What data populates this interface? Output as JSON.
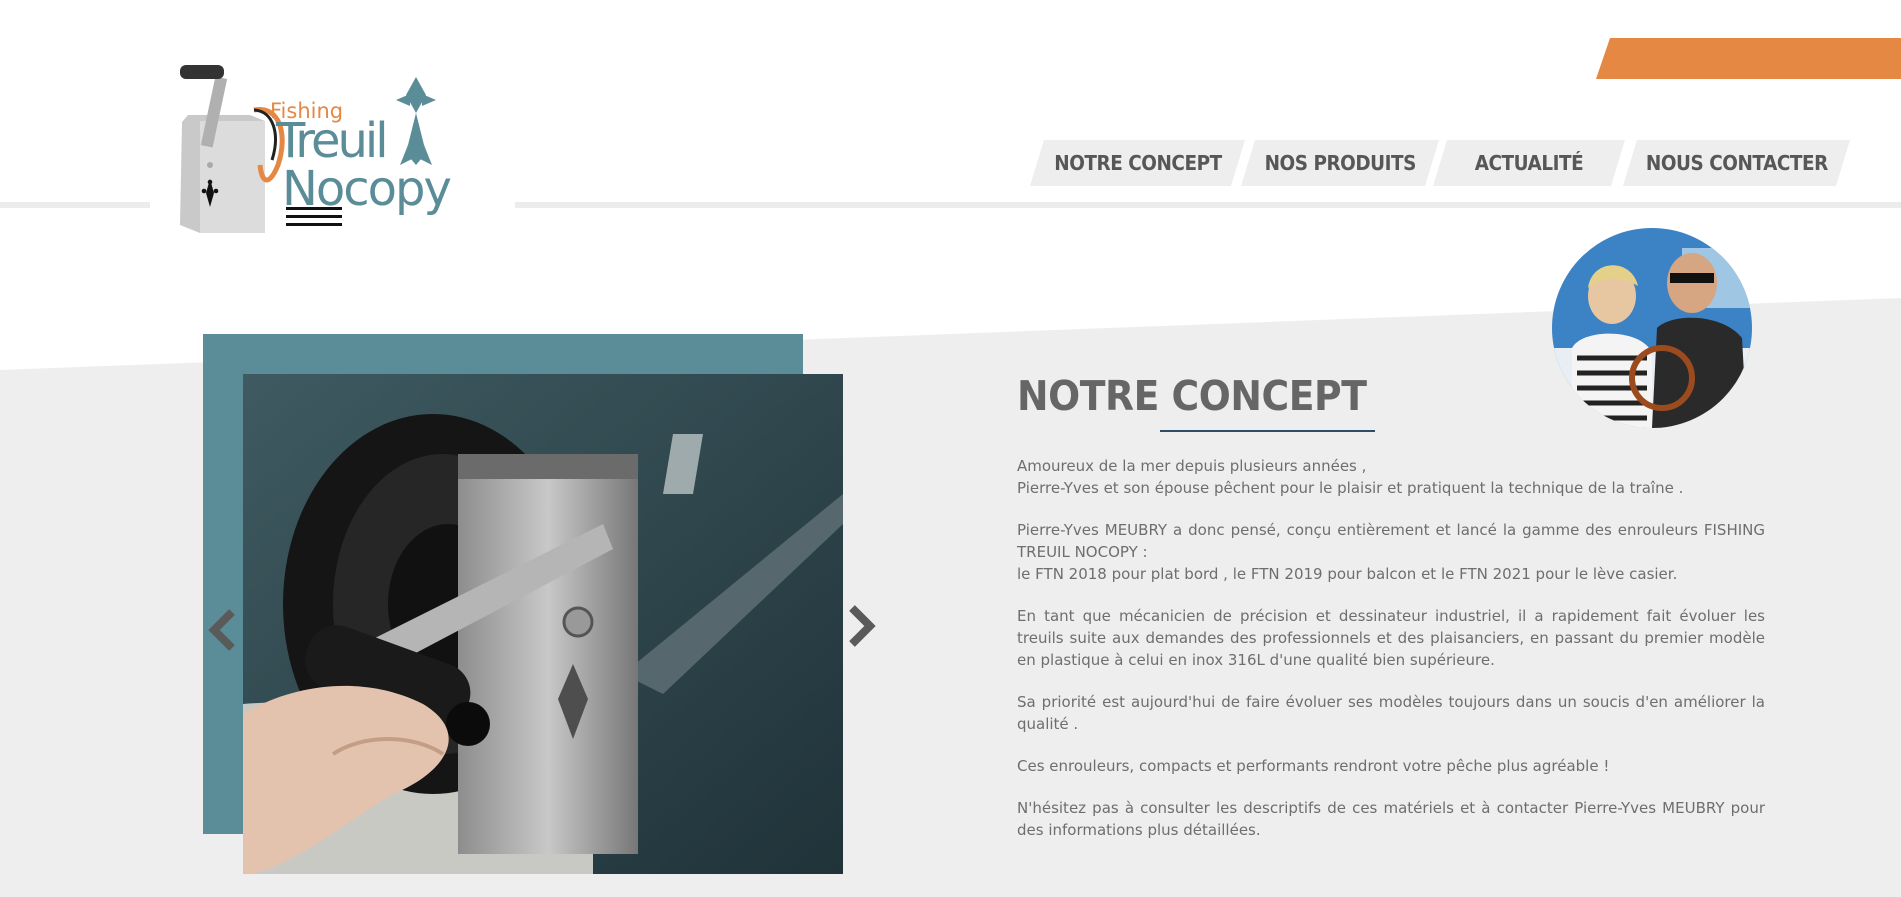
{
  "brand": {
    "fishing": "Fishing",
    "treuil": "Treuil",
    "nocopy": "Nocopy",
    "accent_color": "#e58843",
    "teal_color": "#5a8d97"
  },
  "nav": {
    "items": [
      {
        "label": "NOTRE CONCEPT"
      },
      {
        "label": "NOS PRODUITS"
      },
      {
        "label": "ACTUALITÉ"
      },
      {
        "label": "NOUS CONTACTER"
      }
    ]
  },
  "slider": {
    "prev_icon": "chevron-left-icon",
    "next_icon": "chevron-right-icon"
  },
  "concept": {
    "title": "NOTRE CONCEPT",
    "paragraphs": [
      [
        "Amoureux de la mer depuis plusieurs années ,",
        "Pierre-Yves et son épouse pêchent pour le plaisir et pratiquent la technique de la traîne ."
      ],
      [
        "Pierre-Yves MEUBRY a donc pensé, conçu entièrement et lancé la gamme des enrouleurs FISHING TREUIL NOCOPY :",
        "le FTN 2018 pour plat bord , le FTN 2019 pour balcon et le FTN 2021 pour le lève casier."
      ],
      [
        "En tant que mécanicien de précision et dessinateur industriel, il a rapidement fait évoluer les treuils suite aux demandes des professionnels et des plaisanciers, en passant du premier modèle en plastique à celui en inox 316L d'une qualité bien supérieure."
      ],
      [
        "Sa priorité est aujourd'hui de faire évoluer ses modèles toujours dans un soucis d'en améliorer la qualité ."
      ],
      [
        "Ces enrouleurs, compacts et performants rendront votre pêche plus agréable !"
      ],
      [
        "N'hésitez pas à consulter les descriptifs de ces matériels et à contacter Pierre-Yves MEUBRY pour des informations plus détaillées."
      ]
    ]
  }
}
